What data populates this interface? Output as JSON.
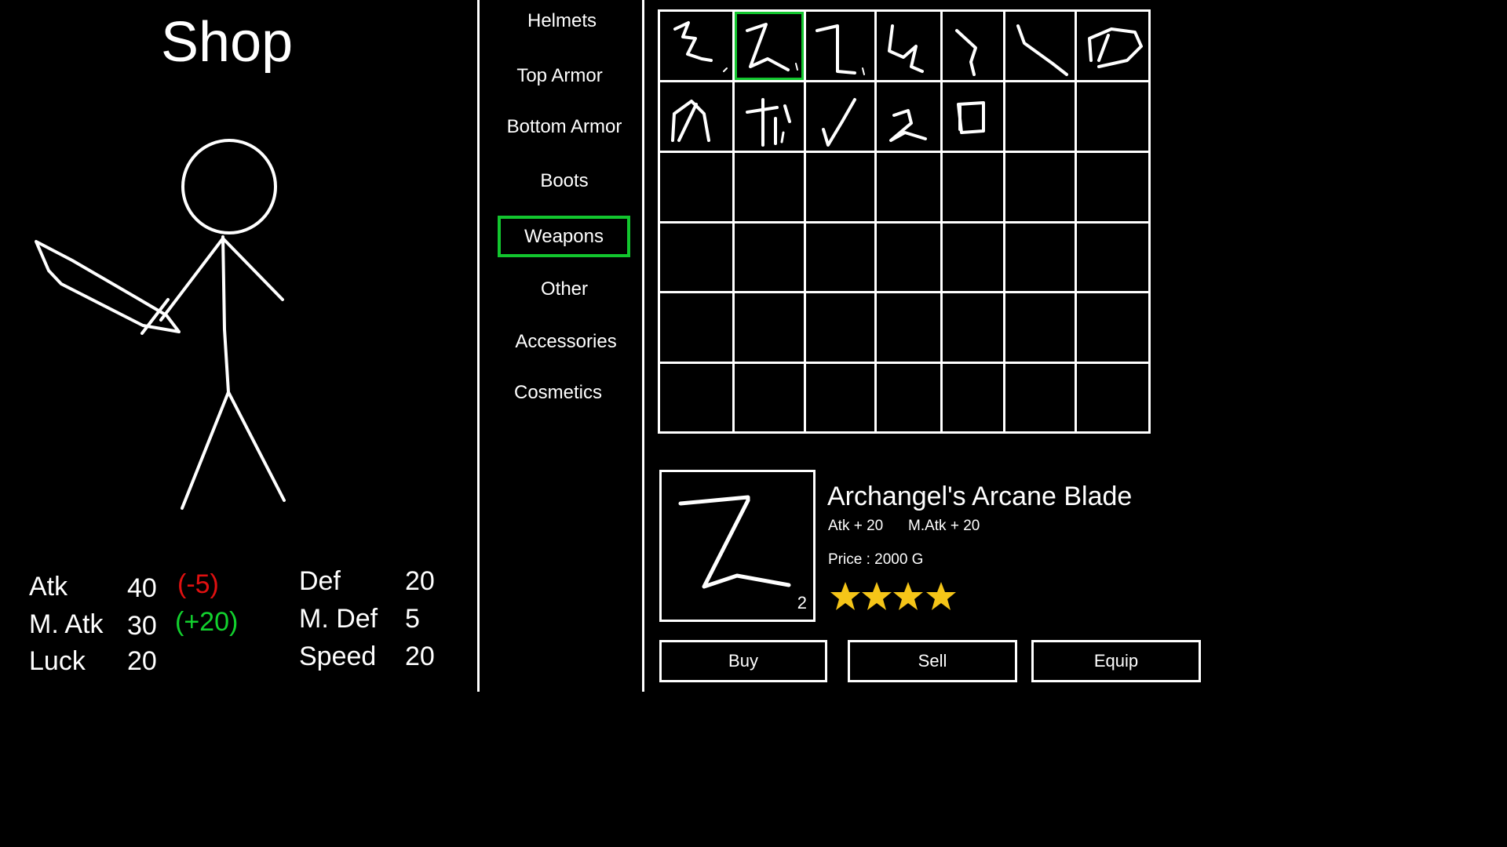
{
  "title": "Shop",
  "stats": {
    "atk": {
      "label": "Atk",
      "value": "40",
      "mod": "(-5)"
    },
    "matk": {
      "label": "M. Atk",
      "value": "30",
      "mod": "(+20)"
    },
    "luck": {
      "label": "Luck",
      "value": "20"
    },
    "def": {
      "label": "Def",
      "value": "20"
    },
    "mdef": {
      "label": "M. Def",
      "value": "5"
    },
    "speed": {
      "label": "Speed",
      "value": "20"
    }
  },
  "categories": [
    {
      "label": "Helmets",
      "selected": false
    },
    {
      "label": "Top Armor",
      "selected": false
    },
    {
      "label": "Bottom Armor",
      "selected": false
    },
    {
      "label": "Boots",
      "selected": false
    },
    {
      "label": "Weapons",
      "selected": true
    },
    {
      "label": "Other",
      "selected": false
    },
    {
      "label": "Accessories",
      "selected": false
    },
    {
      "label": "Cosmetics",
      "selected": false
    }
  ],
  "inventory": {
    "columns": 7,
    "rows": 6,
    "selected_slot": 1,
    "items": [
      {
        "icon": "squiggle-z-icon"
      },
      {
        "icon": "z-blade-icon"
      },
      {
        "icon": "seven-blade-icon"
      },
      {
        "icon": "hook-blade-icon"
      },
      {
        "icon": "curved-blade-icon"
      },
      {
        "icon": "slash-blade-icon"
      },
      {
        "icon": "ring-blade-icon"
      },
      {
        "icon": "leaf-blade-icon"
      },
      {
        "icon": "trident-icon"
      },
      {
        "icon": "check-blade-icon"
      },
      {
        "icon": "two-blade-icon"
      },
      {
        "icon": "square-shield-icon"
      }
    ]
  },
  "selected_item": {
    "name": "Archangel's Arcane Blade",
    "stat1": "Atk + 20",
    "stat2": "M.Atk + 20",
    "price": "Price : 2000 G",
    "quantity": "2",
    "rating": 4,
    "icon": "z-blade-icon"
  },
  "buttons": {
    "buy": "Buy",
    "sell": "Sell",
    "equip": "Equip"
  },
  "colors": {
    "selection": "#12c52e",
    "negative": "#e01010",
    "positive": "#12d12e",
    "star": "#f5c518"
  }
}
